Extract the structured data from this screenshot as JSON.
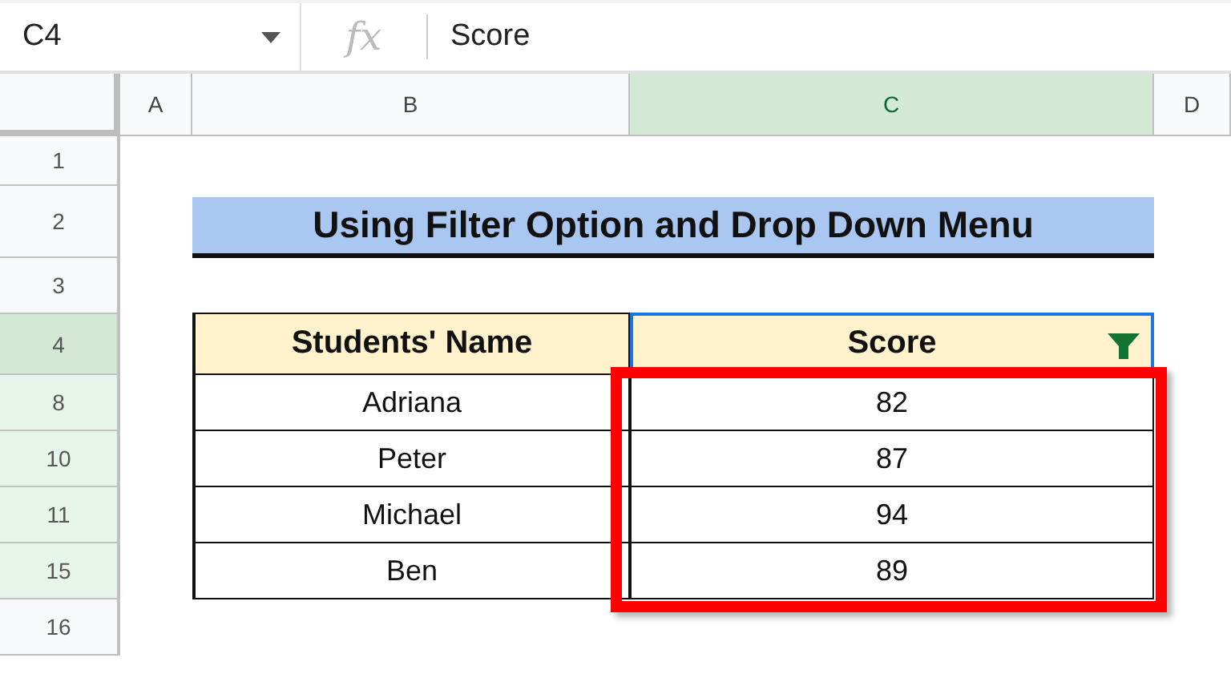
{
  "formula_bar": {
    "cell_ref": "C4",
    "fx": "fx",
    "value": "Score"
  },
  "columns": [
    {
      "label": "A",
      "selected": false
    },
    {
      "label": "B",
      "selected": false
    },
    {
      "label": "C",
      "selected": true
    },
    {
      "label": "D",
      "selected": false
    }
  ],
  "rows": [
    {
      "label": "1",
      "kind": "empty",
      "selected": false,
      "filtered": false
    },
    {
      "label": "2",
      "kind": "title",
      "selected": false,
      "filtered": false,
      "text": "Using Filter Option and Drop Down Menu"
    },
    {
      "label": "3",
      "kind": "empty",
      "selected": false,
      "filtered": false
    },
    {
      "label": "4",
      "kind": "header",
      "selected": true,
      "filtered": false,
      "cells": [
        "Students' Name",
        "Score"
      ],
      "filter_on": true
    },
    {
      "label": "8",
      "kind": "data",
      "selected": false,
      "filtered": true,
      "cells": [
        "Adriana",
        "82"
      ]
    },
    {
      "label": "10",
      "kind": "data",
      "selected": false,
      "filtered": true,
      "cells": [
        "Peter",
        "87"
      ]
    },
    {
      "label": "11",
      "kind": "data",
      "selected": false,
      "filtered": true,
      "cells": [
        "Michael",
        "94"
      ]
    },
    {
      "label": "15",
      "kind": "data",
      "selected": false,
      "filtered": true,
      "cells": [
        "Ben",
        "89"
      ]
    },
    {
      "label": "16",
      "kind": "empty",
      "selected": false,
      "filtered": false
    }
  ],
  "highlight": {
    "shown": true
  }
}
